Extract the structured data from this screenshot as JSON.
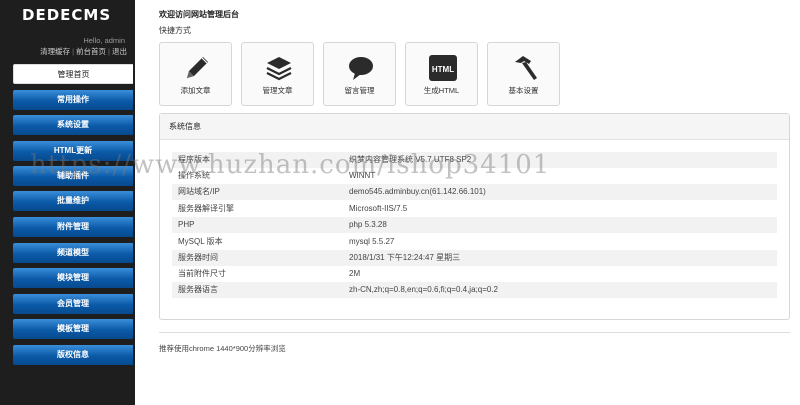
{
  "sidebar": {
    "logo": "DEDECMS",
    "hello": "Hello, admin",
    "links": [
      "清理缓存",
      "前台首页",
      "退出"
    ],
    "items": [
      {
        "label": "管理首页",
        "active": true
      },
      {
        "label": "常用操作"
      },
      {
        "label": "系统设置"
      },
      {
        "label": "HTML更新"
      },
      {
        "label": "辅助插件"
      },
      {
        "label": "批量维护"
      },
      {
        "label": "附件管理"
      },
      {
        "label": "频道模型"
      },
      {
        "label": "模块管理"
      },
      {
        "label": "会员管理"
      },
      {
        "label": "模板管理"
      },
      {
        "label": "版权信息"
      }
    ]
  },
  "main": {
    "welcome": "欢迎访问网站管理后台",
    "quick_label": "快捷方式",
    "shortcuts": [
      {
        "label": "添加文章",
        "icon": "pencil-icon"
      },
      {
        "label": "管理文章",
        "icon": "stack-icon"
      },
      {
        "label": "留言管理",
        "icon": "chat-bubble-icon"
      },
      {
        "label": "生成HTML",
        "icon": "html-icon",
        "icon_text": "HTML"
      },
      {
        "label": "基本设置",
        "icon": "hammer-icon"
      }
    ],
    "sysinfo_title": "系统信息",
    "sysinfo": [
      {
        "key": "程序版本",
        "value": "织梦内容管理系统 V5.7 UTF8 SP2"
      },
      {
        "key": "操作系统",
        "value": "WINNT"
      },
      {
        "key": "网站域名/IP",
        "value": "demo545.adminbuy.cn(61.142.66.101)"
      },
      {
        "key": "服务器解译引擎",
        "value": "Microsoft-IIS/7.5"
      },
      {
        "key": "PHP",
        "value": "php 5.3.28"
      },
      {
        "key": "MySQL 版本",
        "value": "mysql 5.5.27"
      },
      {
        "key": "服务器时间",
        "value": "2018/1/31 下午12:24:47 星期三"
      },
      {
        "key": "当前附件尺寸",
        "value": "2M"
      },
      {
        "key": "服务器语言",
        "value": "zh-CN,zh;q=0.8,en;q=0.6,fi;q=0.4,ja;q=0.2"
      }
    ],
    "browser_note": "推荐使用chrome 1440*900分辨率浏览"
  },
  "watermark": "https://www.huzhan.com/ishop34101",
  "colors": {
    "sidebar_bg": "#1e1e1e",
    "nav_blue": "#0b5aa8"
  }
}
